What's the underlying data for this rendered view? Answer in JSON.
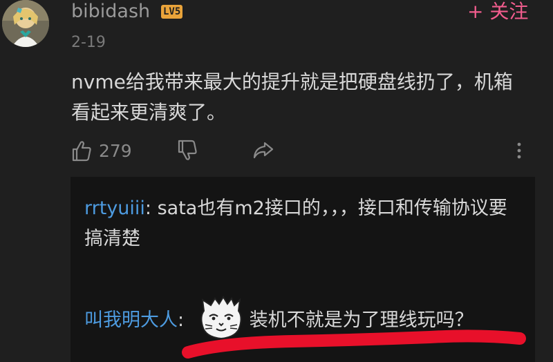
{
  "comment": {
    "username": "bibidash",
    "level": "LV5",
    "follow_label": "+ 关注",
    "date": "2-19",
    "text": "nvme给我带来最大的提升就是把硬盘线扔了，机箱看起来更清爽了。",
    "likes": "279",
    "icons": {
      "like": "thumbs-up-icon",
      "dislike": "thumbs-down-icon",
      "share": "share-icon",
      "more": "more-vertical-icon"
    }
  },
  "replies": [
    {
      "user": "rrtyuiii",
      "separator": ": ",
      "text": "sata也有m2接口的，，，接口和传输协议要搞清楚"
    },
    {
      "user": "叫我明大人",
      "separator": ": ",
      "text": "装机不就是为了理线玩吗？"
    }
  ],
  "colors": {
    "background": "#1f1f1f",
    "reply_background": "#141414",
    "username": "#9a9a9a",
    "reply_user": "#4d9be0",
    "follow": "#f25d8e",
    "level_badge": "#e9a33a",
    "annotation": "#e8102a"
  }
}
